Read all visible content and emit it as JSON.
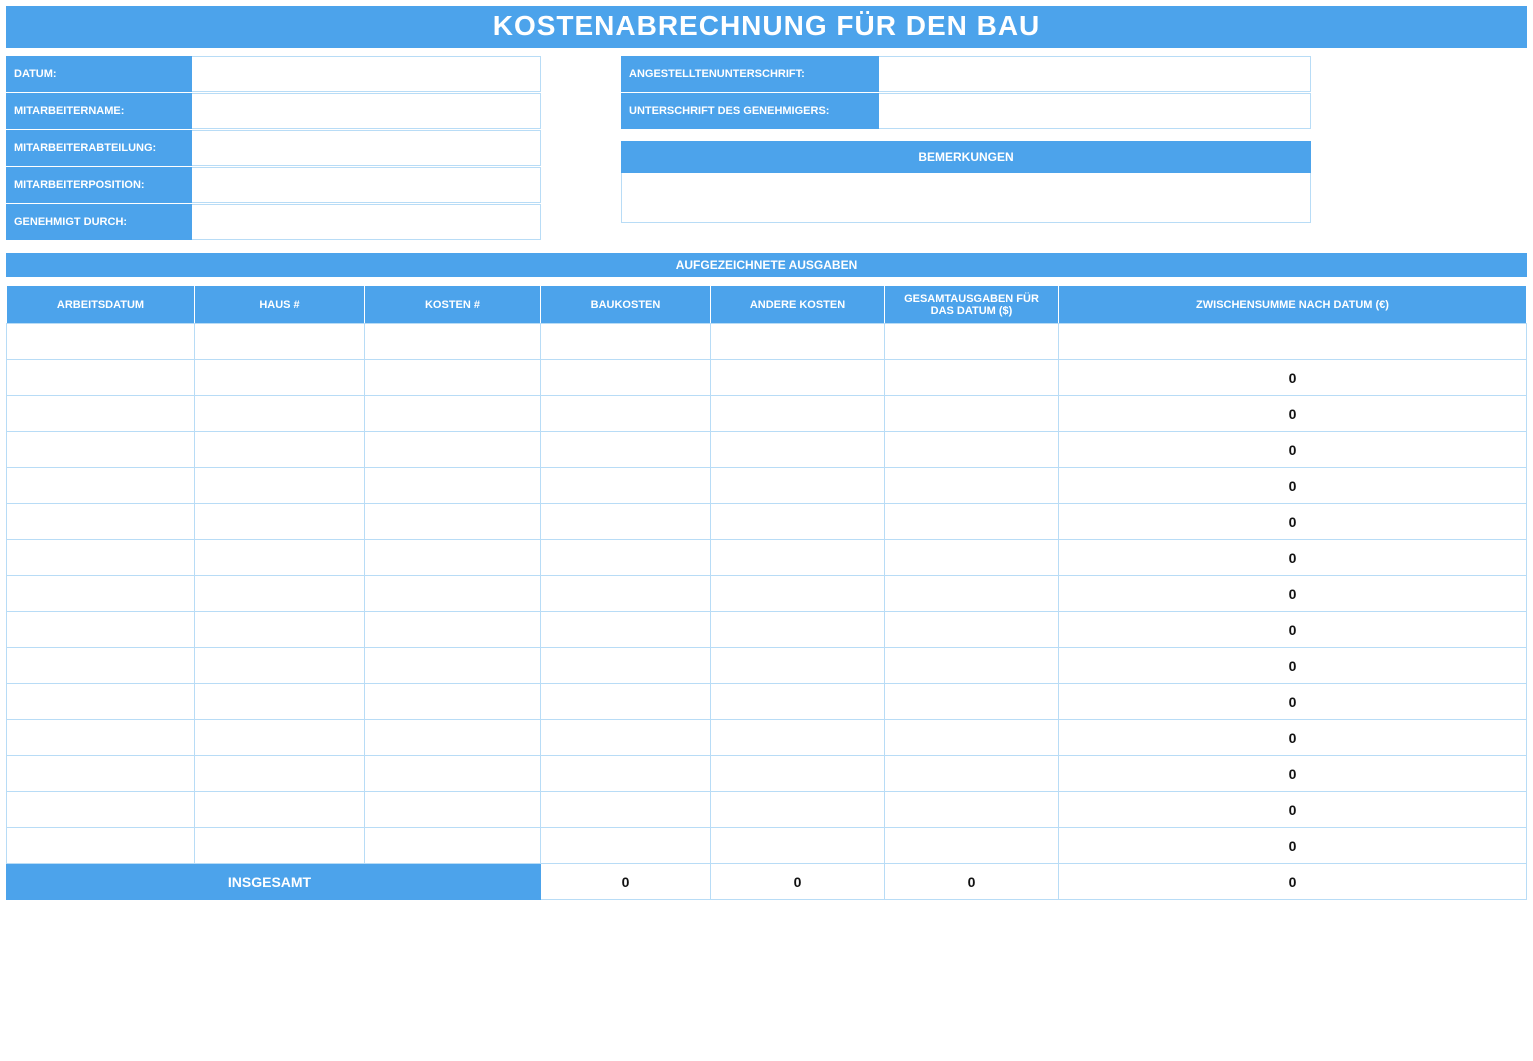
{
  "title": "KOSTENABRECHNUNG FÜR DEN BAU",
  "left_fields": [
    {
      "label": "DATUM:",
      "value": ""
    },
    {
      "label": "MITARBEITERNAME:",
      "value": ""
    },
    {
      "label": "MITARBEITERABTEILUNG:",
      "value": ""
    },
    {
      "label": "MITARBEITERPOSITION:",
      "value": ""
    },
    {
      "label": "GENEHMIGT DURCH:",
      "value": ""
    }
  ],
  "right_fields": [
    {
      "label": "ANGESTELLTENUNTERSCHRIFT:",
      "value": ""
    },
    {
      "label": "UNTERSCHRIFT DES GENEHMIGERS:",
      "value": ""
    }
  ],
  "remarks": {
    "header": "BEMERKUNGEN",
    "value": ""
  },
  "expenses": {
    "section_header": "AUFGEZEICHNETE AUSGABEN",
    "columns": [
      "ARBEITSDATUM",
      "HAUS #",
      "KOSTEN #",
      "BAUKOSTEN",
      "ANDERE KOSTEN",
      "GESAMTAUSGABEN FÜR DAS DATUM ($)",
      "ZWISCHENSUMME NACH DATUM (€)"
    ],
    "rows": [
      {
        "date": "",
        "house": "",
        "cost": "",
        "bau": "",
        "other": "",
        "total": "",
        "sub": ""
      },
      {
        "date": "",
        "house": "",
        "cost": "",
        "bau": "",
        "other": "",
        "total": "",
        "sub": "0"
      },
      {
        "date": "",
        "house": "",
        "cost": "",
        "bau": "",
        "other": "",
        "total": "",
        "sub": "0"
      },
      {
        "date": "",
        "house": "",
        "cost": "",
        "bau": "",
        "other": "",
        "total": "",
        "sub": "0"
      },
      {
        "date": "",
        "house": "",
        "cost": "",
        "bau": "",
        "other": "",
        "total": "",
        "sub": "0"
      },
      {
        "date": "",
        "house": "",
        "cost": "",
        "bau": "",
        "other": "",
        "total": "",
        "sub": "0"
      },
      {
        "date": "",
        "house": "",
        "cost": "",
        "bau": "",
        "other": "",
        "total": "",
        "sub": "0"
      },
      {
        "date": "",
        "house": "",
        "cost": "",
        "bau": "",
        "other": "",
        "total": "",
        "sub": "0"
      },
      {
        "date": "",
        "house": "",
        "cost": "",
        "bau": "",
        "other": "",
        "total": "",
        "sub": "0"
      },
      {
        "date": "",
        "house": "",
        "cost": "",
        "bau": "",
        "other": "",
        "total": "",
        "sub": "0"
      },
      {
        "date": "",
        "house": "",
        "cost": "",
        "bau": "",
        "other": "",
        "total": "",
        "sub": "0"
      },
      {
        "date": "",
        "house": "",
        "cost": "",
        "bau": "",
        "other": "",
        "total": "",
        "sub": "0"
      },
      {
        "date": "",
        "house": "",
        "cost": "",
        "bau": "",
        "other": "",
        "total": "",
        "sub": "0"
      },
      {
        "date": "",
        "house": "",
        "cost": "",
        "bau": "",
        "other": "",
        "total": "",
        "sub": "0"
      },
      {
        "date": "",
        "house": "",
        "cost": "",
        "bau": "",
        "other": "",
        "total": "",
        "sub": "0"
      }
    ],
    "totals": {
      "label": "INSGESAMT",
      "bau": "0",
      "other": "0",
      "total": "0",
      "sub": "0"
    }
  }
}
